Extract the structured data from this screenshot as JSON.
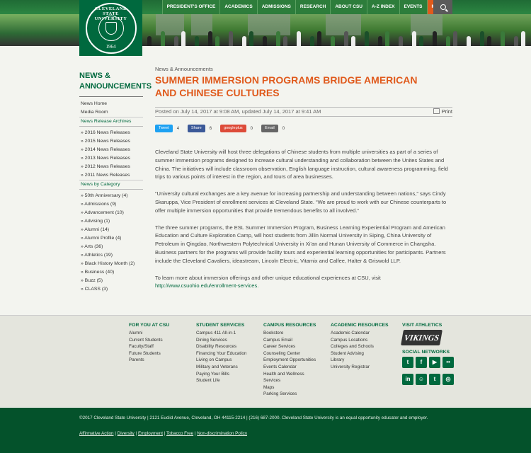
{
  "nav": {
    "items": [
      "PRESIDENT'S OFFICE",
      "ACADEMICS",
      "ADMISSIONS",
      "RESEARCH",
      "ABOUT CSU",
      "A-Z INDEX",
      "EVENTS",
      "MYCSU"
    ],
    "search_icon": "search-icon",
    "accent": "#e05a1c",
    "brand": "#00693e"
  },
  "logo": {
    "name": "CLEVELAND STATE UNIVERSITY",
    "year": "1964"
  },
  "sidebar": {
    "title": "NEWS & ANNOUNCEMENTS",
    "links": [
      "News Home",
      "Media Room"
    ],
    "archives_label": "News Release Archives",
    "archives": [
      "» 2016 News Releases",
      "» 2015 News Releases",
      "» 2014 News Releases",
      "» 2013 News Releases",
      "» 2012 News Releases",
      "» 2011 News Releases"
    ],
    "category_label": "News by Category",
    "categories": [
      "» 50th Anniversary (4)",
      "» Admissions (9)",
      "» Advancement (10)",
      "» Advising (1)",
      "» Alumni (14)",
      "» Alumni Profile (4)",
      "» Arts (36)",
      "» Athletics (19)",
      "» Black History Month (2)",
      "» Business (40)",
      "» Buzz (5)",
      "» CLASS (3)"
    ]
  },
  "article": {
    "crumb": "News & Announcements",
    "title": "Summer Immersion Programs Bridge American and Chinese Cultures",
    "posted": "Posted on July 14, 2017 at 9:08 AM, updated July 14, 2017 at 9:41 AM",
    "print": "Print",
    "share": [
      {
        "label": "Tweet",
        "count": "4",
        "color": "#1da1f2"
      },
      {
        "label": "Share",
        "count": "6",
        "color": "#3b5998"
      },
      {
        "label": "googleplus",
        "count": "0",
        "color": "#dd4b39"
      },
      {
        "label": "Email",
        "count": "0",
        "color": "#666666"
      }
    ],
    "p1": "Cleveland State University will host three delegations of Chinese students from multiple universities as part of a series of summer immersion programs designed to increase cultural understanding and collaboration between the Unites States and China. The initiatives will include classroom observation, English language instruction, cultural awareness programming, field trips to various points of interest in the region, and tours of area businesses.",
    "p2": "“University cultural exchanges are a key avenue for increasing partnership and understanding between nations,” says Cindy Skaruppa, Vice President of enrollment services at Cleveland State. “We are proud to work with our Chinese counterparts to offer multiple immersion opportunities that provide tremendous benefits to all involved.”",
    "p3": "The three summer programs, the ESL Summer Immersion Program, Business Learning Experiential Program and American Education and Culture Exploration Camp, will host students from Jillin Normal University in Siping, China University of Petroleum in Qingdao, Northwestern Polytechnical University in Xi’an and Hunan University of Commerce in Changsha. Business partners for the programs will provide facility tours and experiential learning opportunities for participants. Partners include the Cleveland Cavaliers, ideastream, Lincoln Electric, Vitamix and Calfee, Halter & Griswold LLP.",
    "p4": "To learn more about immersion offerings and other unique educational experiences at CSU, visit",
    "p4_link": "http://www.csuohio.edu/enrollment-services."
  },
  "footer": {
    "for_you": {
      "head": "FOR YOU AT CSU",
      "items": [
        "Alumni",
        "Current Students",
        "Faculty/Staff",
        "Future Students",
        "Parents"
      ]
    },
    "student": {
      "head": "STUDENT SERVICES",
      "items": [
        "Campus 411 All-in-1",
        "Dining Services",
        "Disability Resources",
        "Financing Your Education",
        "Living on Campus",
        "Military and Veterans",
        "Paying Your Bills",
        "Student Life"
      ]
    },
    "campus": {
      "head": "CAMPUS RESOURCES",
      "items": [
        "Bookstore",
        "Campus Email",
        "Career Services",
        "Counseling Center",
        "Employment Opportunities",
        "Events Calendar",
        "Health and Wellness",
        "Services",
        "Maps",
        "Parking Services"
      ]
    },
    "academic": {
      "head": "ACADEMIC RESOURCES",
      "items": [
        "Academic Calendar",
        "Campus Locations",
        "Colleges and Schools",
        "Student Advising",
        "Library",
        "University Registrar"
      ]
    },
    "athletics_head": "VISIT ATHLETICS",
    "vikings": "VIKINGS",
    "social_head": "SOCIAL NETWORKS",
    "social_icons": [
      "twitter-icon",
      "facebook-icon",
      "youtube-icon",
      "flickr-icon",
      "linkedin-icon",
      "snapchat-icon",
      "tumblr-icon",
      "instagram-icon"
    ]
  },
  "bottom": {
    "copyright": "©2017 Cleveland State University | 2121 Euclid Avenue, Cleveland, OH 44115-2214 | (216) 687-2000. Cleveland State University is an equal opportunity educator and employer.",
    "links": [
      "Affirmative Action",
      "Diversity",
      "Employment",
      "Tobacco Free",
      "Non-discrimination Policy"
    ]
  }
}
